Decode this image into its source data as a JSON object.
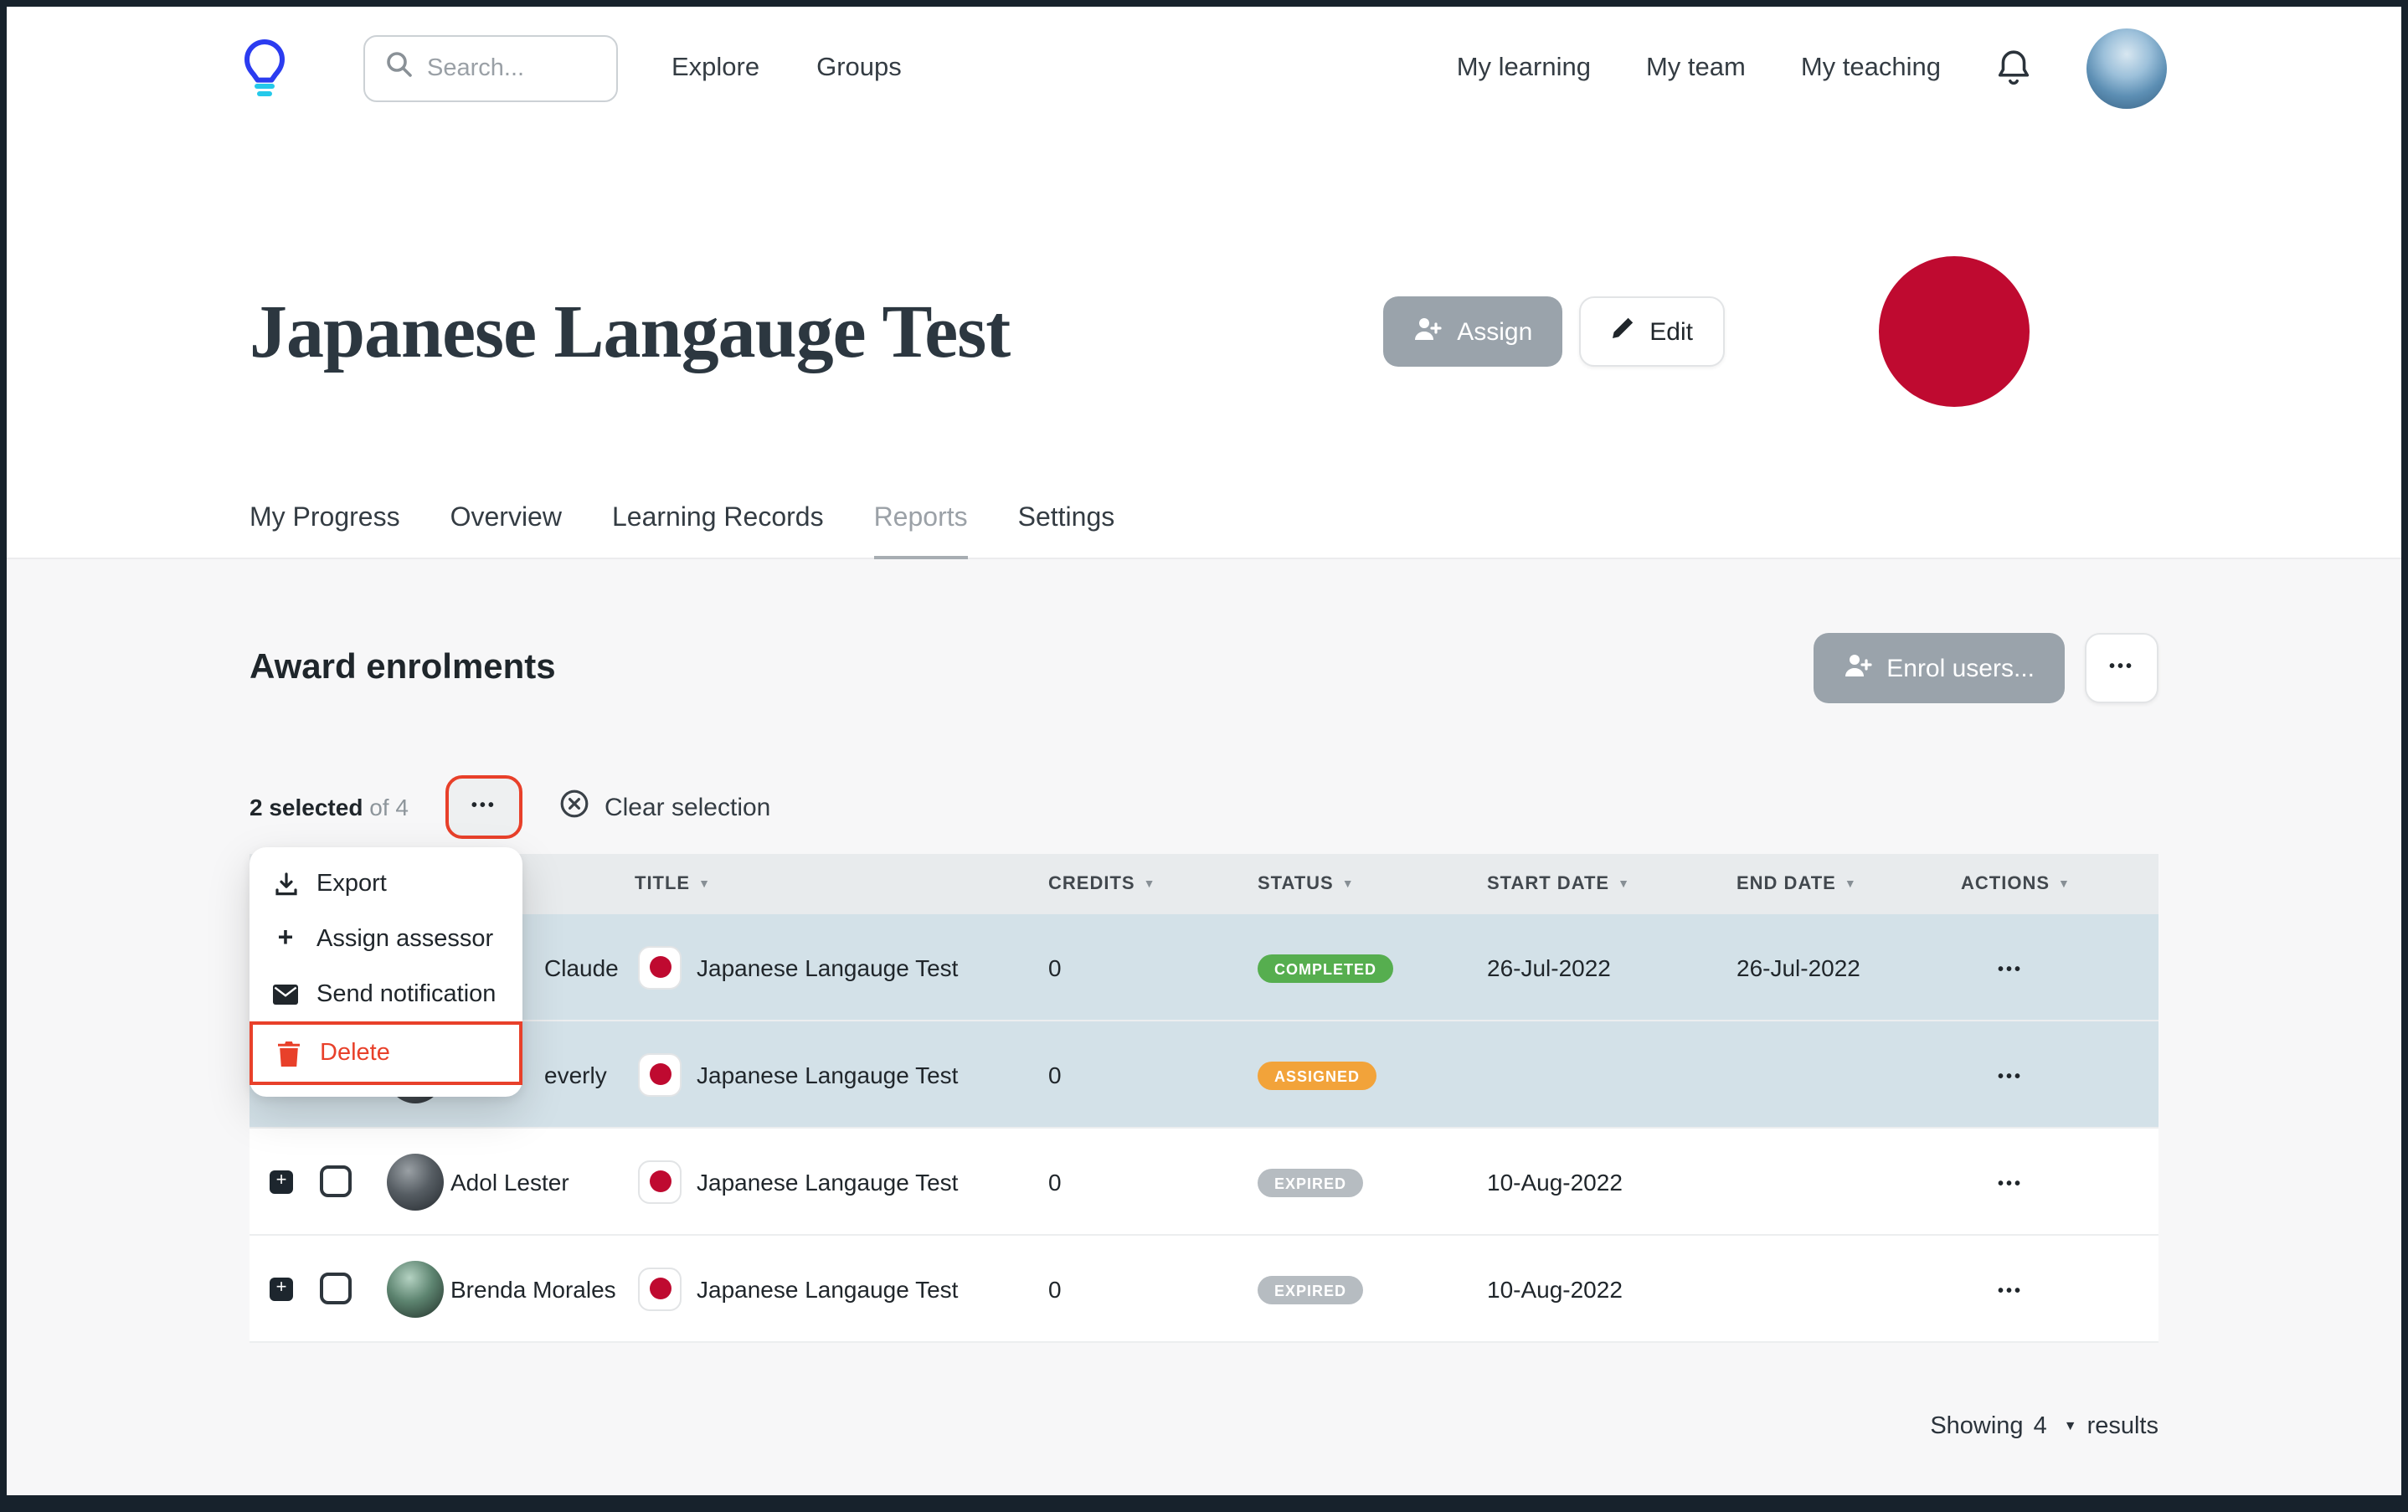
{
  "icons": {
    "ellipsis": "•••",
    "caret_down": "▼",
    "plus": "+"
  },
  "navbar": {
    "search": {
      "placeholder": "Search..."
    },
    "links": {
      "explore": "Explore",
      "groups": "Groups"
    },
    "right": {
      "my_learning": "My learning",
      "my_team": "My team",
      "my_teaching": "My teaching"
    }
  },
  "header": {
    "title": "Japanese Langauge Test",
    "assign_button": "Assign",
    "edit_button": "Edit"
  },
  "tabs": {
    "items": [
      {
        "label": "My Progress",
        "active": false
      },
      {
        "label": "Overview",
        "active": false
      },
      {
        "label": "Learning Records",
        "active": false
      },
      {
        "label": "Reports",
        "active": true
      },
      {
        "label": "Settings",
        "active": false
      }
    ]
  },
  "content": {
    "heading": "Award enrolments",
    "enrol_button": "Enrol users...",
    "selection": {
      "selected_bold": "2 selected",
      "selected_rest": "of 4",
      "clear": "Clear selection"
    },
    "menu": {
      "export": "Export",
      "assign_assessor": "Assign assessor",
      "send_notification": "Send notification",
      "delete": "Delete"
    },
    "table": {
      "headers": {
        "title": "TITLE",
        "credits": "CREDITS",
        "status": "STATUS",
        "start_date": "START DATE",
        "end_date": "END DATE",
        "actions": "ACTIONS"
      },
      "rows": [
        {
          "learner": "Claude",
          "name_partial": true,
          "selected": true,
          "title": "Japanese Langauge Test",
          "credits": "0",
          "status": "COMPLETED",
          "start_date": "26-Jul-2022",
          "end_date": "26-Jul-2022"
        },
        {
          "learner": "everly",
          "name_partial": true,
          "selected": true,
          "title": "Japanese Langauge Test",
          "credits": "0",
          "status": "ASSIGNED",
          "start_date": "",
          "end_date": ""
        },
        {
          "learner": "Adol Lester",
          "name_partial": false,
          "selected": false,
          "title": "Japanese Langauge Test",
          "credits": "0",
          "status": "EXPIRED",
          "start_date": "10-Aug-2022",
          "end_date": ""
        },
        {
          "learner": "Brenda Morales",
          "name_partial": false,
          "selected": false,
          "title": "Japanese Langauge Test",
          "credits": "0",
          "status": "EXPIRED",
          "start_date": "10-Aug-2022",
          "end_date": ""
        }
      ]
    },
    "footer": {
      "showing": "Showing",
      "count": "4",
      "results": "results"
    },
    "status_colors": {
      "COMPLETED": "#56ae4f",
      "ASSIGNED": "#f2a33a",
      "EXPIRED": "#b6bcc1"
    },
    "accent_colors": {
      "highlight_red": "#e8402a",
      "flag_red": "#bf0a30",
      "selected_row": "#d3e1e8"
    }
  }
}
